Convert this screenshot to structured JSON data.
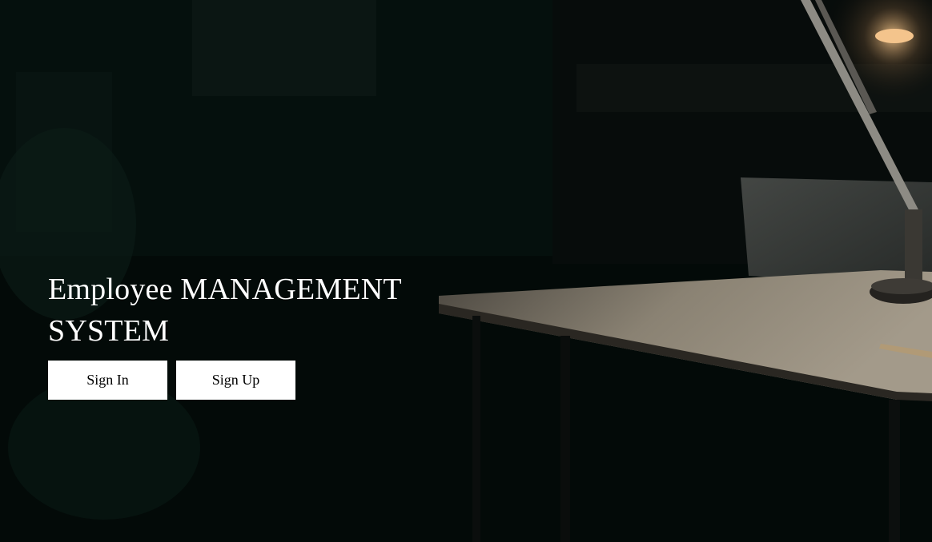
{
  "hero": {
    "title_line1": "Employee MANAGEMENT",
    "title_line2": "SYSTEM",
    "sign_in_label": "Sign In",
    "sign_up_label": "Sign Up"
  },
  "colors": {
    "background": "#020806",
    "title_text": "#ffffff",
    "button_bg": "#ffffff",
    "button_text": "#000000"
  }
}
